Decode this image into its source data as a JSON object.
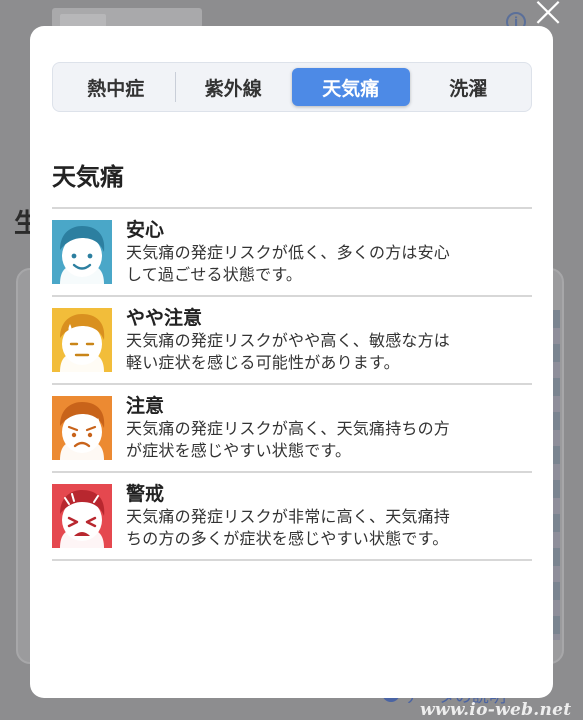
{
  "background": {
    "side_char": "生",
    "footer_link": "データの説明",
    "watermark": "www.io-web.net"
  },
  "tabs": [
    {
      "label": "熱中症",
      "active": false
    },
    {
      "label": "紫外線",
      "active": false
    },
    {
      "label": "天気痛",
      "active": true
    },
    {
      "label": "洗濯",
      "active": false
    }
  ],
  "section_title": "天気痛",
  "levels": [
    {
      "title": "安心",
      "desc1": "天気痛の発症リスクが低く、多くの方は安心",
      "desc2": "して過ごせる状態です。",
      "color": "#4aa7c8",
      "icon": "calm-face-icon"
    },
    {
      "title": "やや注意",
      "desc1": "天気痛の発症リスクがやや高く、敏感な方は",
      "desc2": "軽い症状を感じる可能性があります。",
      "color": "#f2bd3a",
      "icon": "uneasy-face-icon"
    },
    {
      "title": "注意",
      "desc1": "天気痛の発症リスクが高く、天気痛持ちの方",
      "desc2": "が症状を感じやすい状態です。",
      "color": "#ec8a32",
      "icon": "worried-face-icon"
    },
    {
      "title": "警戒",
      "desc1": "天気痛の発症リスクが非常に高く、天気痛持",
      "desc2": "ちの方の多くが症状を感じやすい状態です。",
      "color": "#e5484f",
      "icon": "pained-face-icon"
    }
  ]
}
